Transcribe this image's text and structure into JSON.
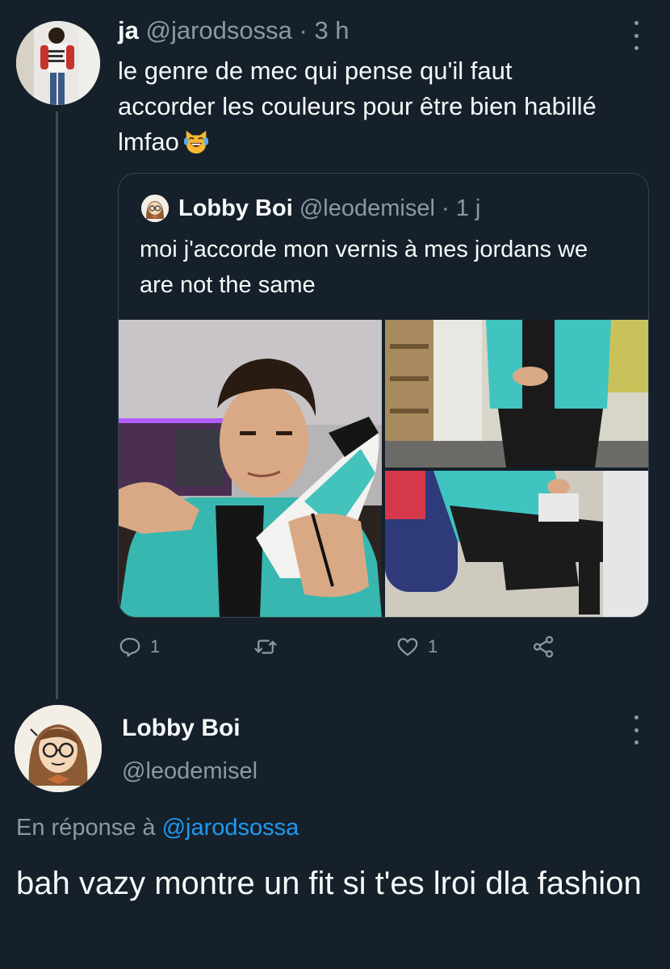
{
  "tweet": {
    "author_name": "ja",
    "author_handle": "@jarodsossa",
    "separator": "·",
    "time": "3 h",
    "text": "le genre de mec qui pense qu'il faut accorder les couleurs pour être bien habillé lmfao",
    "emoji": "laughing-crying-cat-emoji"
  },
  "quoted_tweet": {
    "author_name": "Lobby Boi",
    "author_handle": "@leodemisel",
    "separator": "·",
    "time": "1 j",
    "text": "moi j'accorde mon vernis à mes jordans we are not the same",
    "media_count": 3
  },
  "actions": {
    "reply_count": "1",
    "retweet_count": "",
    "like_count": "1",
    "icons": [
      "reply-icon",
      "retweet-icon",
      "like-icon",
      "share-icon"
    ]
  },
  "reply_tweet": {
    "author_name": "Lobby Boi",
    "author_handle": "@leodemisel",
    "in_reply_prefix": "En réponse à",
    "in_reply_handle": "@jarodsossa",
    "text": "bah vazy montre un fit si t'es lroi dla fashion"
  },
  "colors": {
    "background": "#15202b",
    "text": "#f7f9f9",
    "muted": "#8b98a5",
    "link": "#1d9bf0",
    "border": "#38444d",
    "accent_teal": "#3fc4c0"
  }
}
